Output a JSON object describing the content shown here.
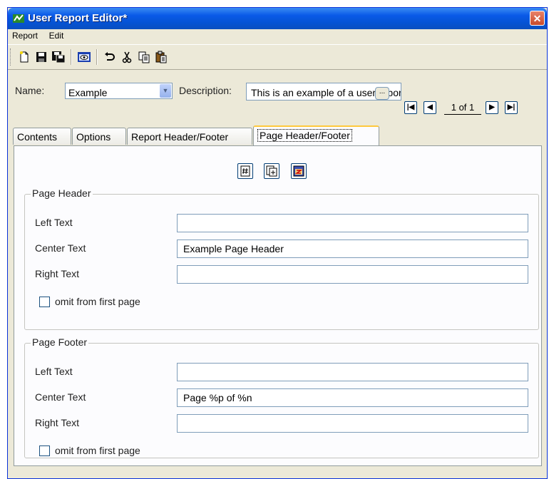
{
  "window": {
    "title": "User Report Editor*",
    "close_glyph": "✕"
  },
  "menubar": {
    "items": [
      "Report",
      "Edit"
    ]
  },
  "toolbar": {
    "icons": [
      "new-icon",
      "save-icon",
      "save-as-icon",
      "preview-icon",
      "undo-icon",
      "cut-icon",
      "copy-icon",
      "paste-icon"
    ]
  },
  "report": {
    "name_label": "Name:",
    "name_value": "Example",
    "description_label": "Description:",
    "description_value": "This is an example of a user report",
    "ellipsis": "...",
    "nav_count": "1 of 1"
  },
  "tabs": [
    "Contents",
    "Options",
    "Report Header/Footer",
    "Page Header/Footer"
  ],
  "active_tab": "Page Header/Footer",
  "insert_icons": [
    "insert-page-number-icon",
    "insert-page-count-icon",
    "insert-date-icon"
  ],
  "page_header": {
    "legend": "Page Header",
    "left_label": "Left Text",
    "left_value": "",
    "center_label": "Center Text",
    "center_value": "Example Page Header",
    "right_label": "Right Text",
    "right_value": "",
    "omit_label": "omit from first page",
    "omit_checked": false
  },
  "page_footer": {
    "legend": "Page Footer",
    "left_label": "Left Text",
    "left_value": "",
    "center_label": "Center Text",
    "center_value": "Page %p of %n",
    "right_label": "Right Text",
    "right_value": "",
    "omit_label": "omit from first page",
    "omit_checked": false
  }
}
